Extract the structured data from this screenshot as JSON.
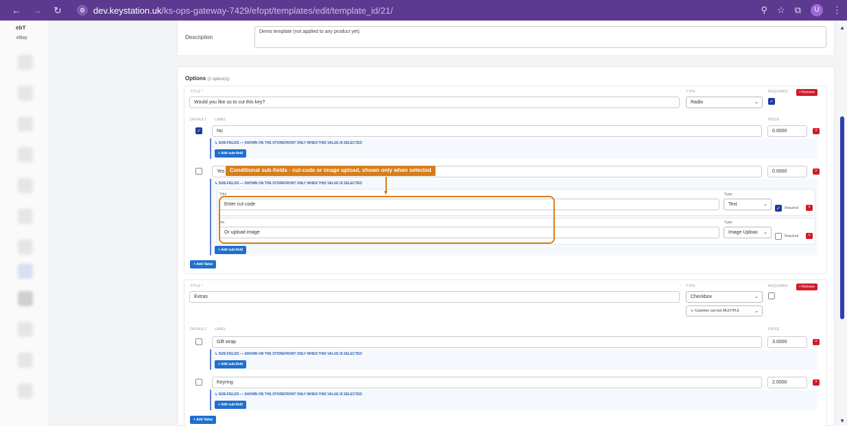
{
  "browser": {
    "url_host": "dev.keystation.uk",
    "url_path": "/ks-ops-gateway-7429/efopt/templates/edit/template_id/21/",
    "avatar": "U"
  },
  "sidebar": {
    "logo": "ebY",
    "label": "eBay"
  },
  "description": {
    "label": "Description",
    "value": "Demo template (not applied to any product yet)."
  },
  "options": {
    "heading": "Options",
    "count": "(2 option(s))",
    "caps": {
      "title": "TITLE *",
      "type": "TYPE",
      "required": "REQUIRED",
      "default": "DEFAULT",
      "label": "LABEL",
      "price": "PRICE"
    },
    "remove_label": "× Remove",
    "subfield_note": "↳ SUB-FIELDS — SHOWN ON THE STOREFRONT ONLY WHEN THIS VALUE IS SELECTED",
    "add_subfield": "+ Add sub-field",
    "add_value": "+ Add Value",
    "option1": {
      "title": "Would you like us to cut this key?",
      "type": "Radio",
      "values": [
        {
          "label": "No",
          "price": "0.0000"
        },
        {
          "label": "Yes",
          "price": "0.0000"
        }
      ],
      "subfields": [
        {
          "title_cap": "Title",
          "title": "Enter cut code",
          "type_cap": "Type",
          "type": "Text",
          "required": "Required"
        },
        {
          "title_cap": "itle",
          "title": "Or upload image",
          "type_cap": "Type",
          "type": "Image Uploac",
          "required": "Required"
        }
      ]
    },
    "option2": {
      "title": "Extras",
      "type": "Checkbox",
      "multi": "↳ Customer can tick MULTIPLE",
      "values": [
        {
          "label": "Gift wrap",
          "price": "3.0000"
        },
        {
          "label": "Keyring",
          "price": "2.0000"
        }
      ]
    }
  },
  "annotation": {
    "callout": "Conditional sub-fields · cut-code or image upload, shown only when selected"
  },
  "colors": {
    "chrome": "#5b3a8f",
    "accent": "#1f3b9e",
    "danger": "#d11a2a",
    "highlight": "#d67d1b",
    "button": "#1f6fcf"
  }
}
